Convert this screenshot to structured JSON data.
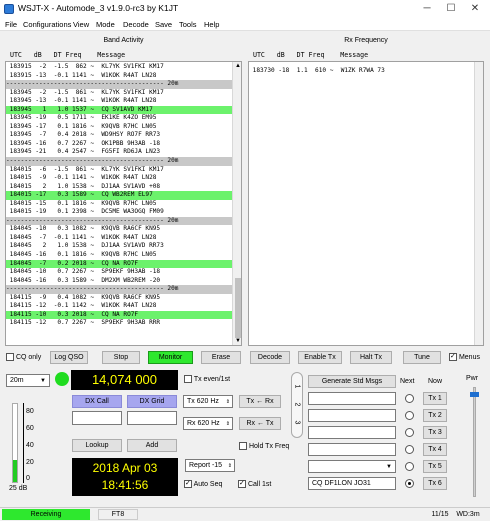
{
  "window": {
    "title": "WSJT-X - Automode_3   v1.9.0-rc3   by K1JT"
  },
  "menu": [
    "File",
    "Configurations",
    "View",
    "Mode",
    "Decode",
    "Save",
    "Tools",
    "Help"
  ],
  "band_activity": {
    "title": "Band Activity",
    "header": " UTC   dB   DT Freq    Message",
    "rows": [
      {
        "t": " 183915  -2  -1.5  862 ~  KL7YK SV1FKI KM17",
        "k": "n"
      },
      {
        "t": " 183915 -13  -0.1 1141 ~  W1KOK R4AT LN28",
        "k": "n"
      },
      {
        "t": "------------------------------------------- 20m",
        "k": "sep"
      },
      {
        "t": " 183945  -2  -1.5  861 ~  KL7YK SV1FKI KM17",
        "k": "n"
      },
      {
        "t": " 183945 -13  -0.1 1141 ~  W1KOK R4AT LN28",
        "k": "n"
      },
      {
        "t": " 183945   1   1.0 1537 ~  CQ SV1AVD KM17",
        "k": "cq"
      },
      {
        "t": " 183945 -19   0.5 1711 ~  EK1KE K4ZO EM95",
        "k": "n"
      },
      {
        "t": " 183945 -17   0.1 1816 ~  K9QVB R7HC LN05",
        "k": "n"
      },
      {
        "t": " 183945  -7   0.4 2018 ~  WD9HSY RO7F RR73",
        "k": "n"
      },
      {
        "t": " 183945 -16   0.7 2267 ~  OK1PBB 9H3AB -18",
        "k": "n"
      },
      {
        "t": " 183945 -21   0.4 2547 ~  FG5FI RD6JA LN23",
        "k": "n"
      },
      {
        "t": "------------------------------------------- 20m",
        "k": "sep"
      },
      {
        "t": " 184015  -6  -1.5  861 ~  KL7YK SV1FKI KM17",
        "k": "n"
      },
      {
        "t": " 184015  -9  -0.1 1141 ~  W1KOK R4AT LN28",
        "k": "n"
      },
      {
        "t": " 184015   2   1.0 1538 ~  DJ1AA SV1AVD +08",
        "k": "n"
      },
      {
        "t": " 184015 -17   0.3 1589 ~  CQ WB2REM EL97",
        "k": "cq"
      },
      {
        "t": " 184015 -15   0.1 1816 ~  K9QVB R7HC LN05",
        "k": "n"
      },
      {
        "t": " 184015 -19   0.1 2398 ~  DC5ME WA3OGQ FM09",
        "k": "n"
      },
      {
        "t": "------------------------------------------- 20m",
        "k": "sep"
      },
      {
        "t": " 184045 -10   0.3 1082 ~  K9QVB RA6CF KN95",
        "k": "n"
      },
      {
        "t": " 184045  -7  -0.1 1141 ~  W1KOK R4AT LN28",
        "k": "n"
      },
      {
        "t": " 184045   2   1.0 1538 ~  DJ1AA SV1AVD RR73",
        "k": "n"
      },
      {
        "t": " 184045 -16   0.1 1816 ~  K9QVB R7HC LN05",
        "k": "n"
      },
      {
        "t": " 184045  -7   0.2 2018 ~  CQ NA RO7F",
        "k": "cq"
      },
      {
        "t": " 184045 -10   0.7 2267 ~  SP9EKF 9H3AB -18",
        "k": "n"
      },
      {
        "t": " 184045 -16   0.3 1589 ~  DM2XM WB2REM -20",
        "k": "n"
      },
      {
        "t": "------------------------------------------- 20m",
        "k": "sep"
      },
      {
        "t": " 184115  -9   0.4 1082 ~  K9QVB RA6CF KN95",
        "k": "n"
      },
      {
        "t": " 184115 -12  -0.1 1142 ~  W1KOK R4AT LN28",
        "k": "n"
      },
      {
        "t": " 184115 -10   0.3 2018 ~  CQ NA RO7F",
        "k": "cq"
      },
      {
        "t": " 184115 -12   0.7 2267 ~  SP9EKF 9H3AB RRR",
        "k": "n"
      }
    ]
  },
  "rx_frequency": {
    "title": "Rx Frequency",
    "header": " UTC   dB   DT Freq    Message",
    "rows": [
      " 183730 -18  1.1  610 ~  W1ZK R7WA 73"
    ]
  },
  "buttons": {
    "cq_only": "CQ only",
    "log_qso": "Log QSO",
    "stop": "Stop",
    "monitor": "Monitor",
    "erase": "Erase",
    "decode": "Decode",
    "enable_tx": "Enable Tx",
    "halt_tx": "Halt Tx",
    "tune": "Tune",
    "menus": "Menus"
  },
  "band_select": "20m",
  "frequency": "14,074 000",
  "tx_even": "Tx even/1st",
  "tx_hz": "Tx  620  Hz",
  "rx_hz": "Rx  620  Hz",
  "tx_to_rx": "Tx ← Rx",
  "rx_to_tx": "Rx ← Tx",
  "rx_tx_swap": "Rx ↔ Tx",
  "hold_tx_freq": "Hold Tx Freq",
  "dx_call": "DX Call",
  "dx_grid": "DX Grid",
  "lookup": "Lookup",
  "add": "Add",
  "date": "2018 Apr 03",
  "time": "18:41:56",
  "report": "Report -15",
  "auto_seq": "Auto Seq",
  "call_1st": "Call 1st",
  "meter": {
    "ticks": [
      "80",
      "60",
      "40",
      "20",
      "0"
    ],
    "level_db": "25 dB",
    "level_fraction": 0.28
  },
  "tabs": [
    "1",
    "2",
    "3"
  ],
  "gen_std_msgs": "Generate Std Msgs",
  "next": "Next",
  "now": "Now",
  "pwr": "Pwr",
  "messages": [
    "",
    "",
    "",
    "",
    "",
    "CQ DF1LON JO31"
  ],
  "tx_buttons": [
    "Tx 1",
    "Tx 2",
    "Tx 3",
    "Tx 4",
    "Tx 5",
    "Tx 6"
  ],
  "status": {
    "receiving": "Receiving",
    "mode": "FT8",
    "progress": "11/15",
    "wd": "WD:3m"
  }
}
